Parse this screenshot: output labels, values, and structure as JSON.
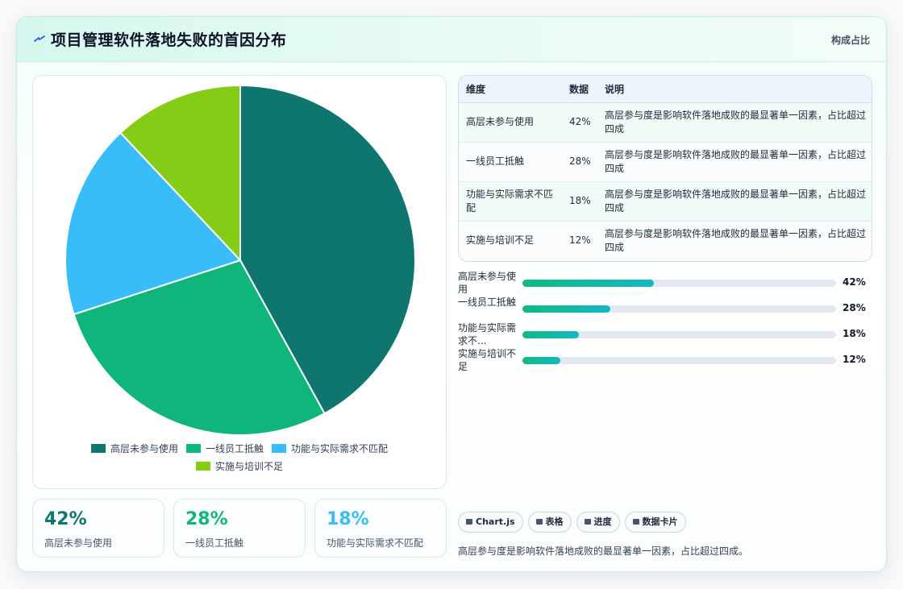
{
  "header": {
    "title": "项目管理软件落地失败的首因分布",
    "right_label": "构成占比",
    "icon": "lightning-icon"
  },
  "chart_data": {
    "type": "pie",
    "categories": [
      "高层未参与使用",
      "一线员工抵触",
      "功能与实际需求不匹配",
      "实施与培训不足"
    ],
    "values": [
      42,
      28,
      18,
      12
    ],
    "colors": [
      "#0e766e",
      "#10b57c",
      "#38bdf8",
      "#84cc16"
    ],
    "legend_position": "bottom"
  },
  "stats": [
    {
      "value": "42%",
      "label": "高层未参与使用",
      "color": "#0e766e"
    },
    {
      "value": "28%",
      "label": "一线员工抵触",
      "color": "#10b57c"
    },
    {
      "value": "18%",
      "label": "功能与实际需求不匹配",
      "color": "#38bdf8"
    }
  ],
  "table": {
    "headers": [
      "维度",
      "数据",
      "说明"
    ],
    "rows": [
      [
        "高层未参与使用",
        "42%",
        "高层参与度是影响软件落地成败的最显著单一因素，占比超过四成"
      ],
      [
        "一线员工抵触",
        "28%",
        "高层参与度是影响软件落地成败的最显著单一因素，占比超过四成"
      ],
      [
        "功能与实际需求不匹配",
        "18%",
        "高层参与度是影响软件落地成败的最显著单一因素，占比超过四成"
      ],
      [
        "实施与培训不足",
        "12%",
        "高层参与度是影响软件落地成败的最显著单一因素，占比超过四成"
      ]
    ]
  },
  "progress": [
    {
      "label": "高层未参与使用",
      "pct": "42%",
      "value": 42
    },
    {
      "label": "一线员工抵触",
      "pct": "28%",
      "value": 28
    },
    {
      "label": "功能与实际需求不...",
      "pct": "18%",
      "value": 18
    },
    {
      "label": "实施与培训不足",
      "pct": "12%",
      "value": 12
    }
  ],
  "tags": [
    {
      "label": "Chart.js",
      "icon": "chart-icon"
    },
    {
      "label": "表格",
      "icon": "table-icon"
    },
    {
      "label": "进度",
      "icon": "progress-icon"
    },
    {
      "label": "数据卡片",
      "icon": "sparkle-icon"
    }
  ],
  "footnote": "高层参与度是影响软件落地成败的最显著单一因素，占比超过四成。"
}
